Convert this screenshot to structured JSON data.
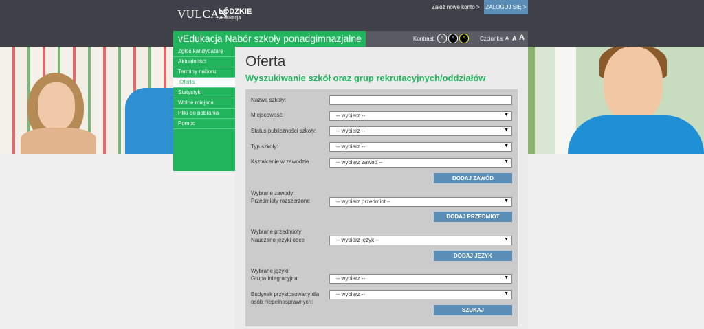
{
  "header": {
    "logo_vulcan": "VULCAN",
    "logo_region": "ŁÓDZKIE",
    "logo_sub": "vEdukacja",
    "register_link": "Załóż nowe konto >",
    "login_button": "ZALOGUJ SIĘ >",
    "contrast_label": "Kontrast:",
    "contrast_options": [
      "A",
      "A",
      "A"
    ],
    "font_label": "Czcionka:",
    "font_sizes": [
      "A",
      "A",
      "A"
    ]
  },
  "app_title": "vEdukacja Nabór szkoły ponadgimnazjalne",
  "menu": [
    {
      "label": "Zgłoś kandydaturę",
      "active": false
    },
    {
      "label": "Aktualności",
      "active": false
    },
    {
      "label": "Terminy naboru",
      "active": false
    },
    {
      "label": "Oferta",
      "active": true
    },
    {
      "label": "Statystyki",
      "active": false
    },
    {
      "label": "Wolne miejsca",
      "active": false
    },
    {
      "label": "Pliki do pobrania",
      "active": false
    },
    {
      "label": "Pomoc",
      "active": false
    }
  ],
  "page": {
    "title": "Oferta",
    "subtitle": "Wyszukiwanie szkół oraz grup rekrutacyjnych/oddziałów"
  },
  "form": {
    "school_name_label": "Nazwa szkoły:",
    "school_name_value": "",
    "city_label": "Miejscowość:",
    "city_value": "-- wybierz --",
    "status_label": "Status publiczności szkoły:",
    "status_value": "-- wybierz --",
    "type_label": "Typ szkoły:",
    "type_value": "-- wybierz --",
    "profession_label": "Kształcenie w zawodzie",
    "profession_value": "-- wybierz zawód --",
    "add_profession_button": "DODAJ ZAWÓD",
    "selected_professions_label": "Wybrane zawody:",
    "extended_subjects_label": "Przedmioty rozszerzone",
    "subject_value": "-- wybierz przedmiot --",
    "add_subject_button": "DODAJ PRZEDMIOT",
    "selected_subjects_label": "Wybrane przedmioty:",
    "languages_label": "Nauczane języki obce",
    "language_value": "-- wybierz język --",
    "add_language_button": "DODAJ JĘZYK",
    "selected_languages_label": "Wybrane języki:",
    "integration_label": "Grupa integracyjna:",
    "integration_value": "-- wybierz --",
    "building_label": "Budynek przystosowany dla osób niepełnosprawnych:",
    "building_value": "-- wybierz --",
    "search_button": "SZUKAJ"
  }
}
